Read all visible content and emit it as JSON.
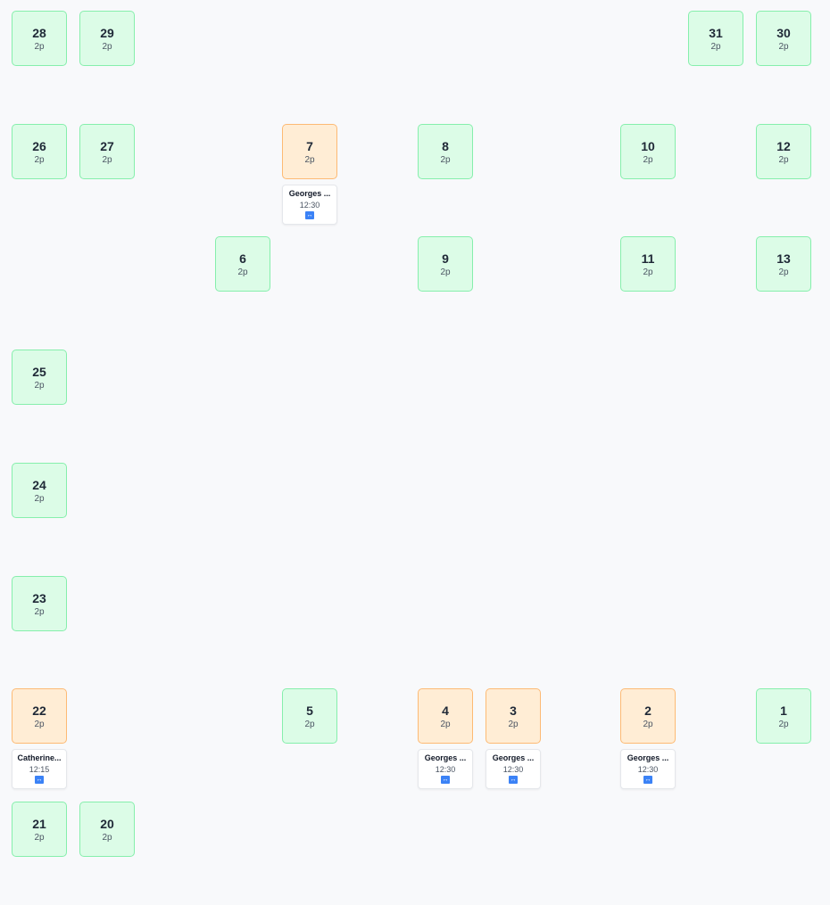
{
  "tables": [
    {
      "number": "28",
      "capacity": "2p",
      "status": "free"
    },
    {
      "number": "29",
      "capacity": "2p",
      "status": "free"
    },
    {
      "number": "31",
      "capacity": "2p",
      "status": "free"
    },
    {
      "number": "30",
      "capacity": "2p",
      "status": "free"
    },
    {
      "number": "26",
      "capacity": "2p",
      "status": "free"
    },
    {
      "number": "27",
      "capacity": "2p",
      "status": "free"
    },
    {
      "number": "7",
      "capacity": "2p",
      "status": "booked",
      "reservation": {
        "guest": "Georges ...",
        "time": "12:30",
        "move_icon": "↔"
      }
    },
    {
      "number": "8",
      "capacity": "2p",
      "status": "free"
    },
    {
      "number": "10",
      "capacity": "2p",
      "status": "free"
    },
    {
      "number": "12",
      "capacity": "2p",
      "status": "free"
    },
    {
      "number": "6",
      "capacity": "2p",
      "status": "free"
    },
    {
      "number": "9",
      "capacity": "2p",
      "status": "free"
    },
    {
      "number": "11",
      "capacity": "2p",
      "status": "free"
    },
    {
      "number": "13",
      "capacity": "2p",
      "status": "free"
    },
    {
      "number": "25",
      "capacity": "2p",
      "status": "free"
    },
    {
      "number": "24",
      "capacity": "2p",
      "status": "free"
    },
    {
      "number": "23",
      "capacity": "2p",
      "status": "free"
    },
    {
      "number": "22",
      "capacity": "2p",
      "status": "booked",
      "reservation": {
        "guest": "Catherine...",
        "time": "12:15",
        "move_icon": "↔"
      }
    },
    {
      "number": "5",
      "capacity": "2p",
      "status": "free"
    },
    {
      "number": "4",
      "capacity": "2p",
      "status": "booked",
      "reservation": {
        "guest": "Georges ...",
        "time": "12:30",
        "move_icon": "↔"
      }
    },
    {
      "number": "3",
      "capacity": "2p",
      "status": "booked",
      "reservation": {
        "guest": "Georges ...",
        "time": "12:30",
        "move_icon": "↔"
      }
    },
    {
      "number": "2",
      "capacity": "2p",
      "status": "booked",
      "reservation": {
        "guest": "Georges ...",
        "time": "12:30",
        "move_icon": "↔"
      }
    },
    {
      "number": "1",
      "capacity": "2p",
      "status": "free"
    },
    {
      "number": "21",
      "capacity": "2p",
      "status": "free"
    },
    {
      "number": "20",
      "capacity": "2p",
      "status": "free"
    }
  ],
  "colors": {
    "free_fill": "#dcfce7",
    "free_border": "#86efac",
    "booked_fill": "#ffedd5",
    "booked_border": "#fdba74",
    "move_icon": "#3b82f6"
  }
}
